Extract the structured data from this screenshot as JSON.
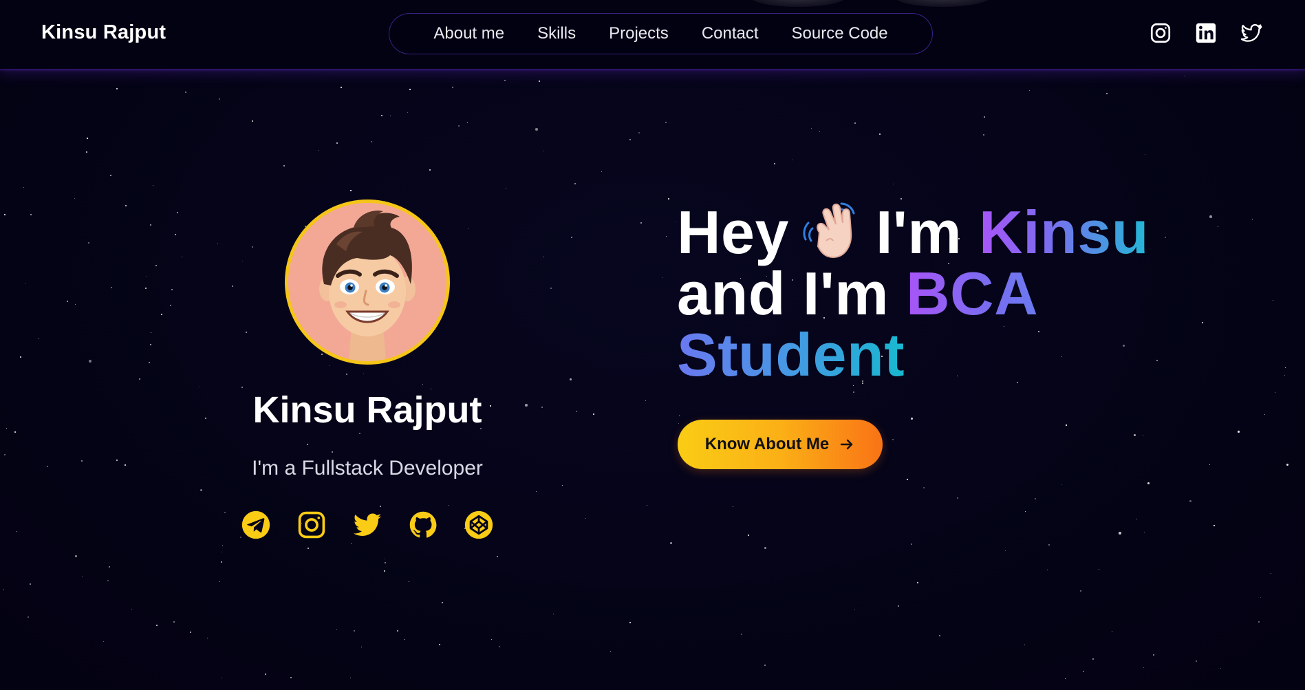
{
  "colors": {
    "background": "#05041a",
    "accent_yellow": "#f5c518",
    "gradient_purple": "#a855f7",
    "gradient_cyan": "#22b8d6",
    "cta_start": "#facc15",
    "cta_end": "#f97316"
  },
  "header": {
    "brand": "Kinsu Rajput",
    "nav_links": [
      {
        "label": "About me"
      },
      {
        "label": "Skills"
      },
      {
        "label": "Projects"
      },
      {
        "label": "Contact"
      },
      {
        "label": "Source Code"
      }
    ],
    "social_icons": [
      "instagram-icon",
      "linkedin-icon",
      "twitter-icon"
    ]
  },
  "profile": {
    "name": "Kinsu Rajput",
    "role": "I'm a Fullstack Developer",
    "avatar_icon": "cartoon-avatar",
    "social_icons": [
      "telegram-icon",
      "instagram-icon",
      "twitter-icon",
      "github-icon",
      "codepen-icon"
    ]
  },
  "hero": {
    "line1_prefix": "Hey",
    "line1_emoji": "waving-hand-emoji",
    "line1_middle": "I'm",
    "line1_name": "Kinsu",
    "line2_prefix": "and I'm",
    "line2_highlight": "BCA",
    "line3_highlight": "Student",
    "cta_label": "Know About Me",
    "cta_icon": "arrow-right-icon"
  }
}
